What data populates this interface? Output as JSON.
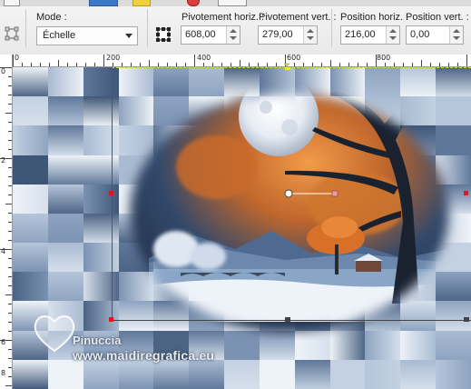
{
  "toolbar": {
    "mode": {
      "label": "Mode :",
      "value": "Échelle"
    },
    "fields": [
      {
        "label": "Pivotement horiz. :",
        "value": "608,00"
      },
      {
        "label": "Pivotement vert. :",
        "value": "279,00"
      },
      {
        "label": "Position horiz. :",
        "value": "216,00"
      },
      {
        "label": "Position vert. :",
        "value": "0,00"
      }
    ]
  },
  "ruler": {
    "horizontal": [
      "0",
      "200",
      "400",
      "600",
      "800"
    ],
    "vertical": [
      "0",
      "2",
      "4",
      "6",
      "8"
    ]
  },
  "watermark": {
    "name": "Pinuccia",
    "site": "www.maidiregrafica.eu"
  },
  "colors": {
    "selection": "#d8d824",
    "handle": "#e01818",
    "accent_button": "#3c78c8"
  }
}
